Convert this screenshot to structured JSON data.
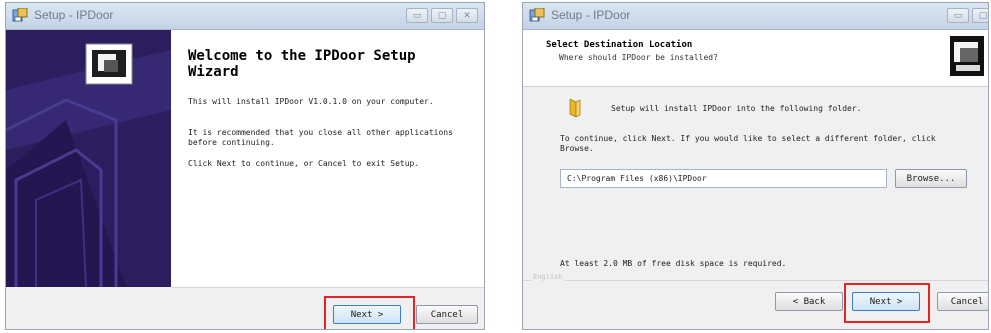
{
  "left_window": {
    "title": "Setup - IPDoor",
    "controls": [
      "▭",
      "▢",
      "✕"
    ],
    "welcome_title": "Welcome to the IPDoor Setup Wizard",
    "paragraphs": [
      "This will install IPDoor V1.0.1.0 on your computer.",
      "It is recommended that you close all other applications before continuing.",
      "Click Next to continue, or Cancel to exit Setup."
    ],
    "next_label": "Next >",
    "cancel_label": "Cancel"
  },
  "right_window": {
    "title": "Setup - IPDoor",
    "controls": [
      "▭",
      "▢"
    ],
    "header_title": "Select Destination Location",
    "header_subtitle": "Where should IPDoor be installed?",
    "install_message": "Setup will install IPDoor into the following folder.",
    "continue_text": "To continue, click Next. If you would like to select a different folder, click Browse.",
    "folder_path": "C:\\Program Files (x86)\\IPDoor",
    "browse_label": "Browse...",
    "disk_space_text": "At least 2.0 MB of free disk space is required.",
    "language_label": "English",
    "back_label": "< Back",
    "next_label": "Next >",
    "cancel_label": "Cancel"
  },
  "colors": {
    "highlight": "#e02626",
    "banner": "#2c1e5e",
    "title_text": "#6d7e90"
  }
}
